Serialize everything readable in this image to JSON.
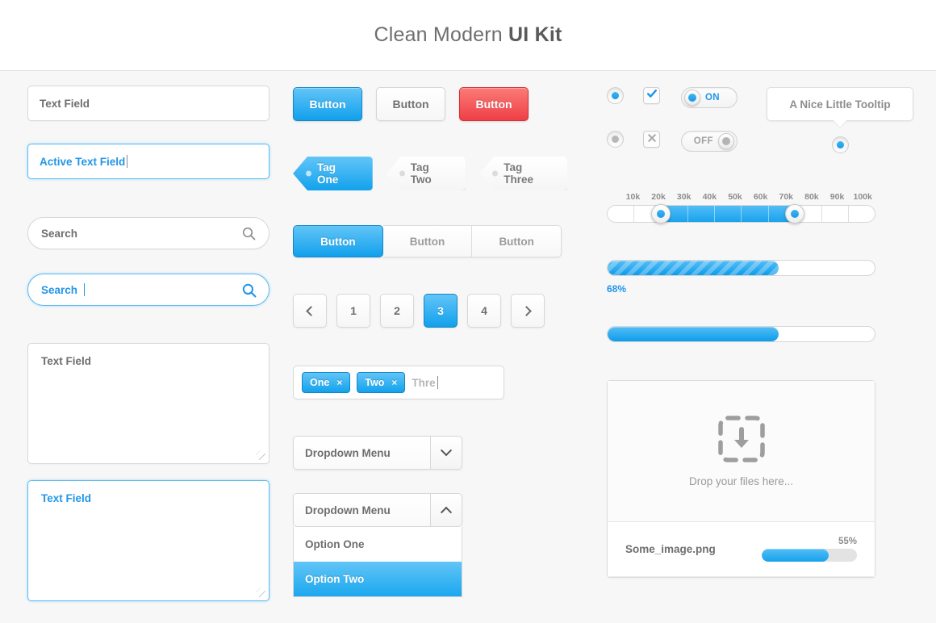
{
  "header": {
    "title_regular": "Clean Modern ",
    "title_bold": "UI Kit"
  },
  "left": {
    "text_field": "Text Field",
    "active_text_field": "Active Text Field",
    "search": "Search",
    "active_search": "Search",
    "textarea": "Text Field",
    "active_textarea": "Text Field",
    "search_icon": "search-icon"
  },
  "buttons": {
    "primary": "Button",
    "default": "Button",
    "danger": "Button"
  },
  "tags": [
    {
      "label": "Tag One",
      "state": "active"
    },
    {
      "label": "Tag Two",
      "state": "default"
    },
    {
      "label": "Tag Three",
      "state": "default"
    }
  ],
  "segmented": {
    "items": [
      "Button",
      "Button",
      "Button"
    ],
    "active_index": 0
  },
  "pagination": {
    "prev": "‹",
    "next": "›",
    "pages": [
      "1",
      "2",
      "3",
      "4"
    ],
    "active": "3"
  },
  "token_input": {
    "tokens": [
      "One",
      "Two"
    ],
    "remove_symbol": "×",
    "typed": "Thre"
  },
  "dropdown_closed": {
    "label": "Dropdown Menu"
  },
  "dropdown_open": {
    "label": "Dropdown Menu",
    "options": [
      "Option One",
      "Option Two"
    ],
    "selected": "Option Two"
  },
  "controls": {
    "radio_on": "radio-selected",
    "radio_off": "radio-unselected",
    "check_on": "check-icon",
    "check_off": "cross-icon",
    "toggle_on_label": "ON",
    "toggle_off_label": "OFF"
  },
  "tooltip": {
    "text": "A Nice Little Tooltip"
  },
  "slider": {
    "ticks": [
      "10k",
      "20k",
      "30k",
      "40k",
      "50k",
      "60k",
      "70k",
      "80k",
      "90k",
      "100k"
    ],
    "min": 0,
    "max": 100,
    "value_low": 20,
    "value_high": 70
  },
  "progress": {
    "striped_value": 68,
    "striped_label": "68%",
    "solid_value": 68
  },
  "dropzone": {
    "label": "Drop your files here...",
    "icon": "download-into-box-icon",
    "file_name": "Some_image.png",
    "file_percent_label": "55%",
    "file_percent": 55
  },
  "colors": {
    "accent_blue": "#11a0ec",
    "accent_blue_light": "#62c5f7",
    "danger_red": "#ee3f45",
    "text_gray": "#6e6e6e",
    "page_bg": "#f7f7f7"
  }
}
